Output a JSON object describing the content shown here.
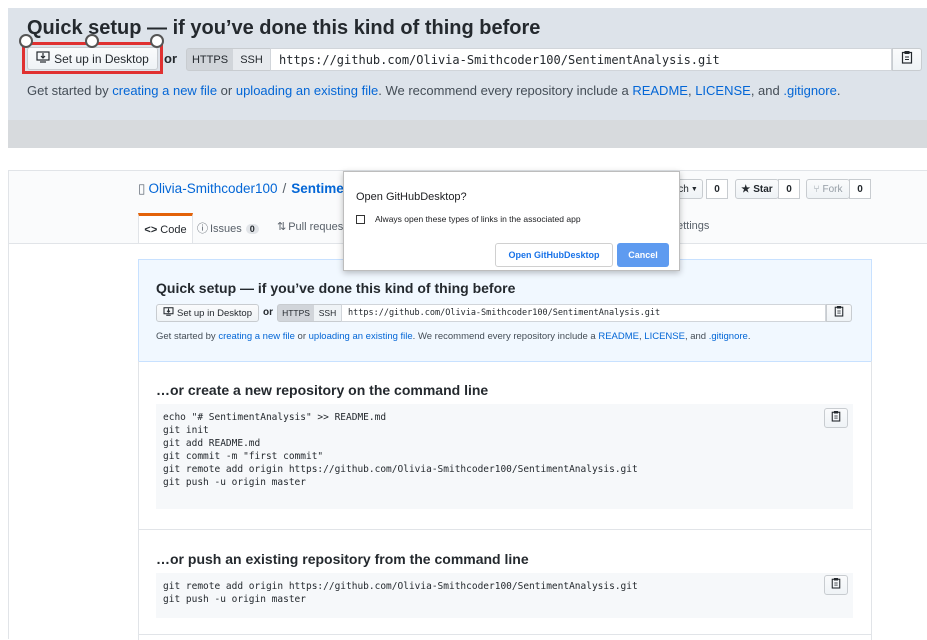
{
  "top": {
    "heading": "Quick setup — if you’ve done this kind of thing before",
    "desktop_button": "Set up in Desktop",
    "or": "or",
    "https": "HTTPS",
    "ssh": "SSH",
    "url": "https://github.com/Olivia-Smithcoder100/SentimentAnalysis.git",
    "getstarted": {
      "t1": "Get started by ",
      "link_new": "creating a new file",
      "t2": " or ",
      "link_upload": "uploading an existing file",
      "t3": ". We recommend every repository include a ",
      "link_readme": "README",
      "t4": ", ",
      "link_license": "LICENSE",
      "t5": ", and ",
      "link_gitignore": ".gitignore",
      "t6": "."
    }
  },
  "repo": {
    "owner": "Olivia-Smithcoder100",
    "sep": "/",
    "name": "Sentime",
    "watch_label": "ch",
    "watch_count": "0",
    "star_label": "Star",
    "star_count": "0",
    "fork_label": "Fork",
    "fork_count": "0"
  },
  "tabs": {
    "code": "Code",
    "issues": "Issues",
    "issues_count": "0",
    "pull": "Pull request",
    "settings": "ettings"
  },
  "dialog": {
    "title": "Open GitHubDesktop?",
    "checkbox_label": "Always open these types of links in the associated app",
    "open_button": "Open GitHubDesktop",
    "cancel_button": "Cancel"
  },
  "inner": {
    "heading": "Quick setup — if you’ve done this kind of thing before",
    "desktop_button": "Set up in Desktop",
    "or": "or",
    "https": "HTTPS",
    "ssh": "SSH",
    "url": "https://github.com/Olivia-Smithcoder100/SentimentAnalysis.git",
    "getstarted": {
      "t1": "Get started by ",
      "link_new": "creating a new file",
      "t2": " or ",
      "link_upload": "uploading an existing file",
      "t3": ". We recommend every repository include a ",
      "link_readme": "README",
      "t4": ", ",
      "link_license": "LICENSE",
      "t5": ", and ",
      "link_gitignore": ".gitignore",
      "t6": "."
    }
  },
  "new_repo": {
    "heading": "…or create a new repository on the command line",
    "lines": [
      "echo \"# SentimentAnalysis\" >> README.md",
      "git init",
      "git add README.md",
      "git commit -m \"first commit\"",
      "git remote add origin https://github.com/Olivia-Smithcoder100/SentimentAnalysis.git",
      "git push -u origin master"
    ]
  },
  "push_repo": {
    "heading": "…or push an existing repository from the command line",
    "lines": [
      "git remote add origin https://github.com/Olivia-Smithcoder100/SentimentAnalysis.git",
      "git push -u origin master"
    ]
  },
  "colors": {
    "accent_blue": "#0366d6",
    "highlight_red": "#e03131",
    "dialog_blue": "#5e9bf0"
  }
}
